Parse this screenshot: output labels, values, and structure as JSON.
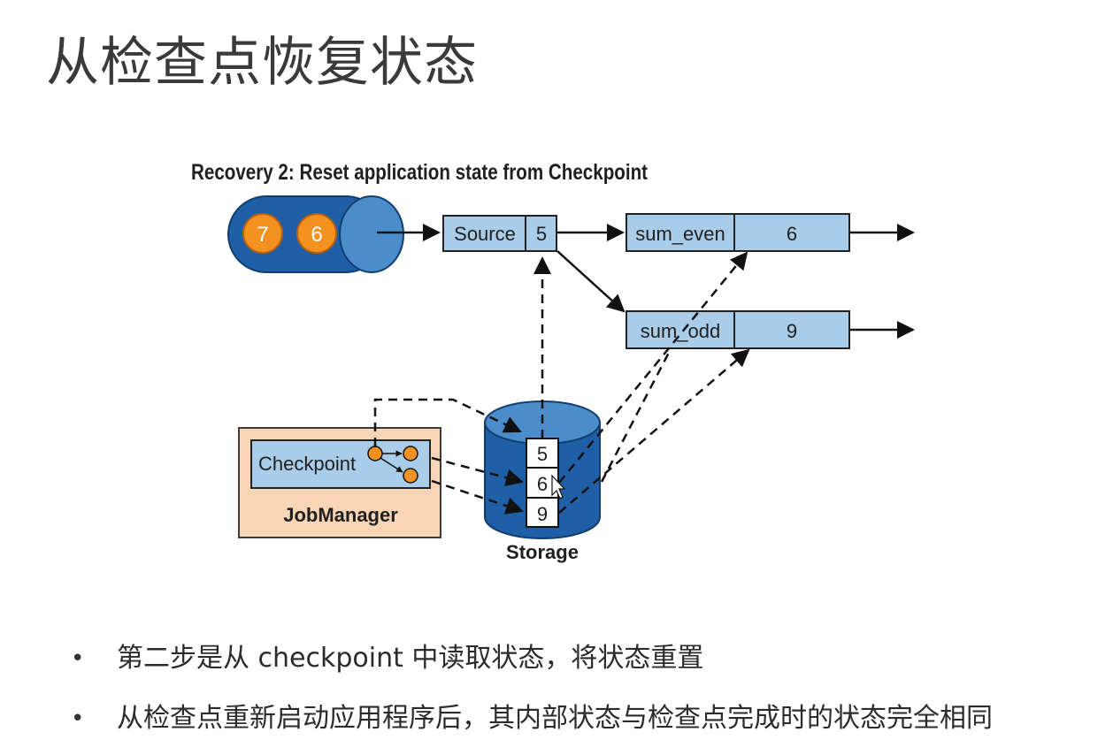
{
  "slide": {
    "title": "从检查点恢复状态"
  },
  "diagram": {
    "caption": "Recovery 2: Reset application state from Checkpoint",
    "queue_items": [
      "7",
      "6"
    ],
    "source": {
      "label": "Source",
      "value": "5"
    },
    "sum_even": {
      "label": "sum_even",
      "value": "6"
    },
    "sum_odd": {
      "label": "sum_odd",
      "value": "9"
    },
    "checkpoint_label": "Checkpoint",
    "jobmanager_label": "JobManager",
    "storage_label": "Storage",
    "storage_values": [
      "5",
      "6",
      "9"
    ],
    "colors": {
      "operator_fill": "#a9cde8",
      "queue_blue": "#1f5fa6",
      "orange": "#f39221",
      "jobmanager_fill": "#f7d5b5"
    }
  },
  "bullets": [
    "第二步是从 checkpoint 中读取状态，将状态重置",
    "从检查点重新启动应用程序后，其内部状态与检查点完成时的状态完全相同"
  ]
}
